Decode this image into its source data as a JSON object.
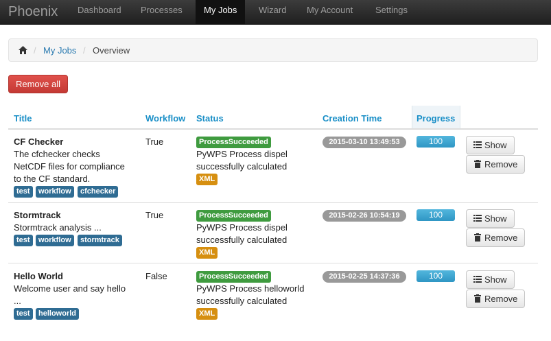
{
  "navbar": {
    "brand": "Phoenix",
    "items": [
      {
        "label": "Dashboard",
        "active": false
      },
      {
        "label": "Processes",
        "active": false
      },
      {
        "label": "My Jobs",
        "active": true
      },
      {
        "label": "Wizard",
        "active": false
      },
      {
        "label": "My Account",
        "active": false
      },
      {
        "label": "Settings",
        "active": false
      }
    ]
  },
  "breadcrumb": {
    "home_icon": "home-icon",
    "separator": "/",
    "link": "My Jobs",
    "current": "Overview"
  },
  "actions": {
    "remove_all": "Remove all"
  },
  "table": {
    "headers": {
      "title": "Title",
      "workflow": "Workflow",
      "status": "Status",
      "creation_time": "Creation Time",
      "progress": "Progress"
    },
    "rows": [
      {
        "title": "CF Checker",
        "description_lines": [
          "The cfchecker checks",
          "NetCDF files for compliance",
          "to the CF standard."
        ],
        "tags": [
          "test",
          "workflow",
          "cfchecker"
        ],
        "workflow": "True",
        "status_label": "ProcessSucceeded",
        "status_lines": [
          "PyWPS Process dispel",
          "successfully calculated"
        ],
        "output": "XML",
        "creation_time": "2015-03-10 13:49:53",
        "progress": 100,
        "progress_label": "100",
        "show_label": "Show",
        "remove_label": "Remove"
      },
      {
        "title": "Stormtrack",
        "description_lines": [
          "Stormtrack analysis ..."
        ],
        "tags": [
          "test",
          "workflow",
          "stormtrack"
        ],
        "workflow": "True",
        "status_label": "ProcessSucceeded",
        "status_lines": [
          "PyWPS Process dispel",
          "successfully calculated"
        ],
        "output": "XML",
        "creation_time": "2015-02-26 10:54:19",
        "progress": 100,
        "progress_label": "100",
        "show_label": "Show",
        "remove_label": "Remove"
      },
      {
        "title": "Hello World",
        "description_lines": [
          "Welcome user and say hello",
          "..."
        ],
        "tags": [
          "test",
          "helloworld"
        ],
        "workflow": "False",
        "status_label": "ProcessSucceeded",
        "status_lines": [
          "PyWPS Process helloworld",
          "successfully calculated"
        ],
        "output": "XML",
        "creation_time": "2015-02-25 14:37:36",
        "progress": 100,
        "progress_label": "100",
        "show_label": "Show",
        "remove_label": "Remove"
      }
    ]
  },
  "colors": {
    "link": "#1a8fc7",
    "success": "#3f9b3f",
    "warning": "#d68f10",
    "danger": "#d9534f",
    "tag": "#2f6c93",
    "time_badge": "#999999",
    "progress": "#2f96c4"
  }
}
